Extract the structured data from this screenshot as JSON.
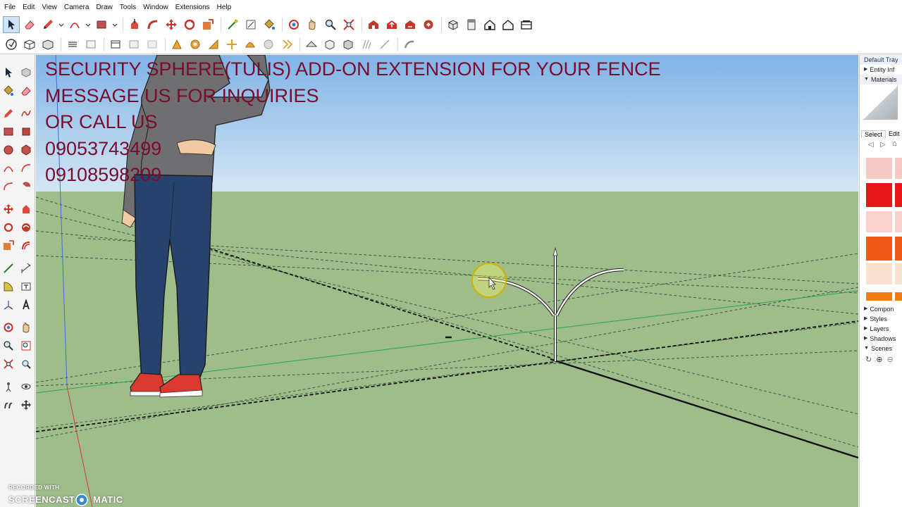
{
  "menu": {
    "items": [
      "File",
      "Edit",
      "View",
      "Camera",
      "Draw",
      "Tools",
      "Window",
      "Extensions",
      "Help"
    ]
  },
  "overlay": {
    "lines": [
      "SECURITY SPHERE(TULIS) ADD-ON EXTENSION FOR YOUR FENCE",
      "MESSAGE US FOR INQUIRIES",
      "OR CALL US",
      "09053743499",
      "09108598209"
    ],
    "color": "#7a0c2e"
  },
  "tray": {
    "title": "Default Tray",
    "entity_info": "Entity Inf",
    "materials": "Materials",
    "select_tab": "Select",
    "edit_tab": "Edit",
    "sections": [
      "Compon",
      "Styles",
      "Layers",
      "Shadows",
      "Scenes"
    ]
  },
  "colors": {
    "sky_top": "#7fb3e6",
    "sky_bottom": "#cfe2f2",
    "ground": "#9fbc8b",
    "accent_red": "#e8171a",
    "accent_orange": "#ef5a16"
  },
  "watermark": {
    "top": "RECORDED WITH",
    "left": "SCREENCAST",
    "right": "MATIC"
  },
  "icons": {
    "toolbar": [
      "select-icon",
      "eraser-icon",
      "pencil-icon",
      "arc-icon",
      "rectangle-icon",
      "push-pull-icon",
      "move-icon",
      "rotate-icon",
      "scale-icon",
      "offset-icon",
      "tape-measure-icon",
      "text-icon",
      "paint-bucket-icon",
      "orbit-icon",
      "pan-icon",
      "zoom-icon",
      "zoom-extents-icon",
      "warehouse-icon",
      "share-icon",
      "extension-icon",
      "iso-view-icon",
      "top-view-icon",
      "front-view-icon",
      "right-view-icon",
      "back-view-icon"
    ]
  }
}
